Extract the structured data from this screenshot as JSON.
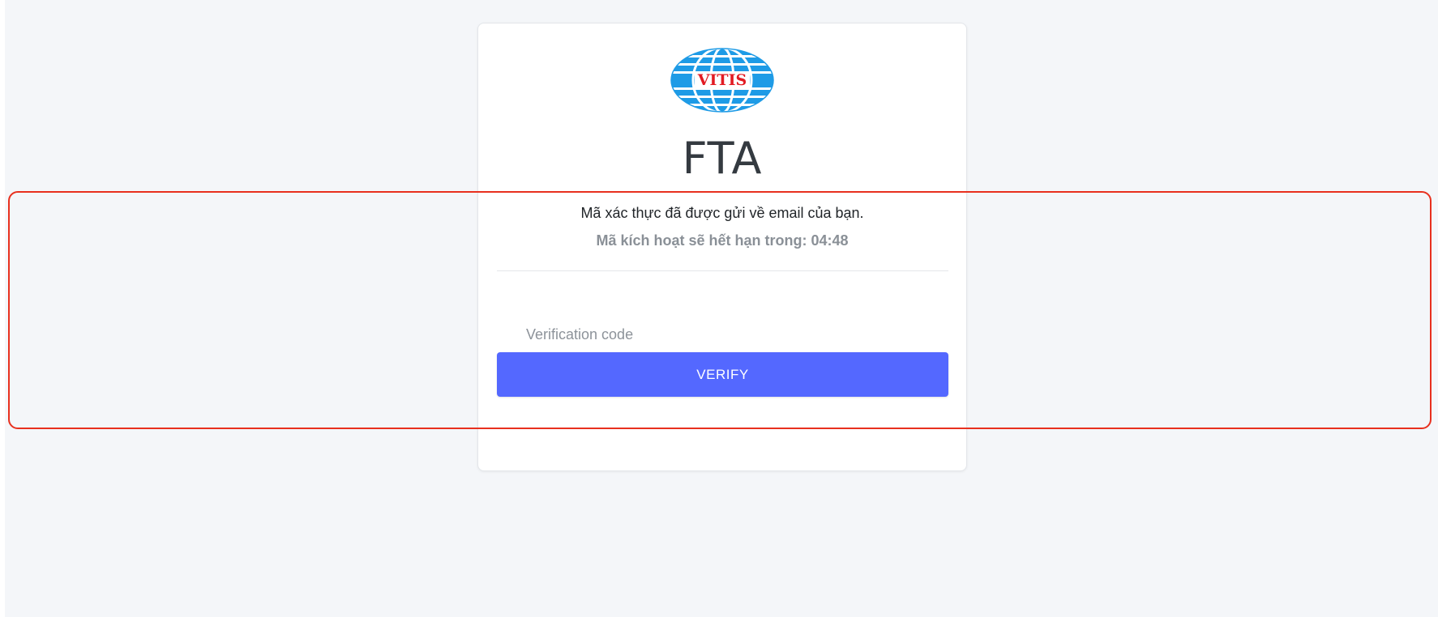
{
  "app": {
    "title": "FTA",
    "logo_text": "VITIS"
  },
  "verification": {
    "message": "Mã xác thực đã được gửi về email của bạn.",
    "expiry_text": "Mã kích hoạt sẽ hết hạn trong: 04:48",
    "input_placeholder": "Verification code",
    "input_value": "",
    "verify_label": "VERIFY"
  },
  "colors": {
    "accent": "#5468ff",
    "logo_blue": "#1e9be6",
    "logo_red": "#e21b23",
    "highlight": "#e8301e"
  }
}
